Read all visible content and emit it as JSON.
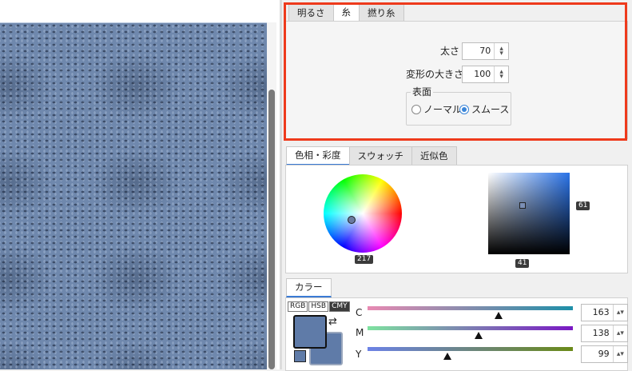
{
  "top_tabs": [
    "明るさ",
    "糸",
    "撚り糸"
  ],
  "yarn": {
    "thickness_label": "太さ",
    "thickness_value": "70",
    "deform_label": "変形の大きさ",
    "deform_value": "100",
    "surface_group": "表面",
    "surface_options": [
      "ノーマル",
      "スムース"
    ],
    "surface_selected": "スムース"
  },
  "color_tabs": [
    "色相・彩度",
    "スウォッチ",
    "近似色"
  ],
  "hue_badge": "217",
  "saturation_badge": "61",
  "brightness_badge": "41",
  "color_panel": {
    "tab": "カラー",
    "modes": [
      "RGB",
      "HSB",
      "CMY"
    ],
    "active_mode": "CMY",
    "swap_icon": "swap-arrows-icon",
    "channels": [
      {
        "label": "C",
        "value": "163",
        "fraction": 0.64
      },
      {
        "label": "M",
        "value": "138",
        "fraction": 0.54
      },
      {
        "label": "Y",
        "value": "99",
        "fraction": 0.39
      }
    ]
  },
  "colors": {
    "accent": "#3a7bd5",
    "highlight": "#ee3a1c",
    "current_color": "#5f7ba8"
  }
}
